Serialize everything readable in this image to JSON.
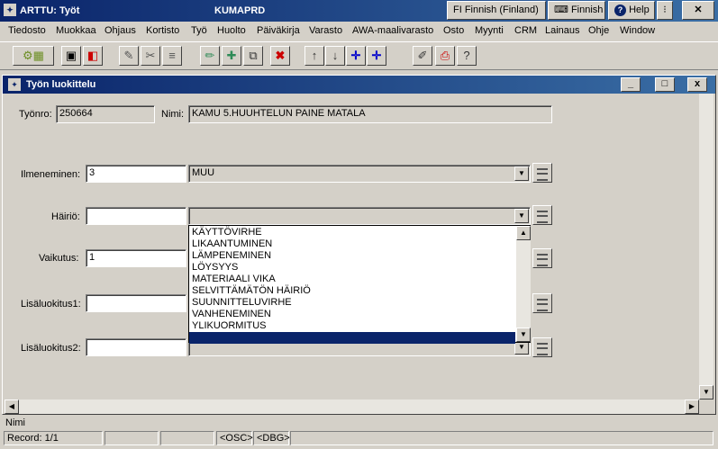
{
  "app": {
    "title": "ARTTU: Työt",
    "center_title": "KUMAPRD"
  },
  "titlebar": {
    "language": "FI  Finnish (Finland)",
    "finnish": "Finnish",
    "help": "Help",
    "options": "⁝",
    "close": "✕"
  },
  "menu": [
    "Tiedosto",
    "Muokkaa",
    "Ohjaus",
    "Kortisto",
    "Työ",
    "Huolto",
    "Päiväkirja",
    "Varasto",
    "AWA-maalivarasto",
    "Osto",
    "Myynti",
    "CRM",
    "Lainaus",
    "Ohje",
    "Window"
  ],
  "window": {
    "title": "Työn luokittelu",
    "min": "_",
    "max": "□",
    "close": "x"
  },
  "form": {
    "tyonro_label": "Työnro:",
    "tyonro_value": "250664",
    "nimi_label": "Nimi:",
    "nimi_value": "KAMU 5.HUUHTELUN PAINE MATALA",
    "ilmeneminen_label": "Ilmeneminen:",
    "ilmeneminen_code": "3",
    "ilmeneminen_value": "MUU",
    "hairio_label": "Häiriö:",
    "hairio_code": "",
    "hairio_value": "",
    "vaikutus_label": "Vaikutus:",
    "vaikutus_code": "1",
    "lisa1_label": "Lisäluokitus1:",
    "lisa1_code": "",
    "lisa2_label": "Lisäluokitus2:",
    "lisa2_code": ""
  },
  "dropdown_options": [
    "KÄYTTÖVIRHE",
    "LIKAANTUMINEN",
    "LÄMPENEMINEN",
    "LÖYSYYS",
    "MATERIAALI VIKA",
    "SELVITTÄMÄTÖN HÄIRIÖ",
    "SUUNNITTELUVIRHE",
    "VANHENEMINEN",
    "YLIKUORMITUS",
    ""
  ],
  "status": {
    "field_name": "Nimi",
    "record": "Record: 1/1",
    "osc": "<OSC>",
    "dbg": "<DBG>"
  }
}
